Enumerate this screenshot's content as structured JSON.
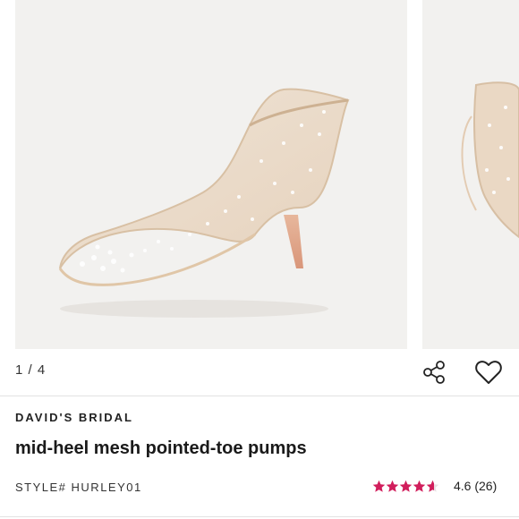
{
  "gallery": {
    "counter": "1 / 4",
    "main_image_alt": "mid-heel mesh pointed-toe pump with crystals",
    "share_icon": "share-icon",
    "favorite_icon": "heart-icon"
  },
  "product": {
    "brand": "DAVID'S BRIDAL",
    "name": "mid-heel mesh pointed-toe pumps",
    "style": "STYLE# HURLEY01",
    "rating": {
      "value": 4.6,
      "label": "4.6 (26)",
      "review_count": 26,
      "star_color": "#d11e5c"
    }
  }
}
